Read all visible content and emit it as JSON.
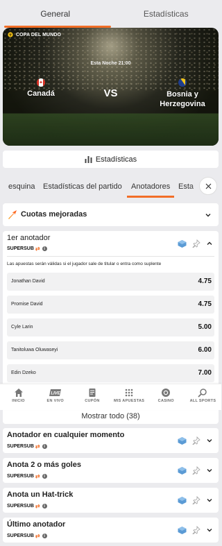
{
  "top_tabs": [
    {
      "label": "General",
      "active": true
    },
    {
      "label": "Estadísticas",
      "active": false
    }
  ],
  "match": {
    "competition": "COPA DEL MUNDO",
    "time": "Esta Noche 21:00",
    "home": "Canadá",
    "away": "Bosnia y Herzegovina",
    "vs": "VS"
  },
  "stats_button": {
    "label": "Estadísticas",
    "icon": "bar-chart-icon"
  },
  "sub_tabs": [
    {
      "label": "esquina",
      "active": false
    },
    {
      "label": "Estadísticas del partido",
      "active": false
    },
    {
      "label": "Anotadores",
      "active": true
    },
    {
      "label": "Esta",
      "active": false
    }
  ],
  "boosted": {
    "title": "Cuotas mejoradas",
    "icon": "boost-arrow-icon"
  },
  "scorer_market": {
    "title": "1er anotador",
    "supersub": "SUPERSUB",
    "note": "Las apuestas serán válidas si el jugador sale de titular o entra como suplente",
    "rows": [
      {
        "name": "Jonathan David",
        "odd": "4.75"
      },
      {
        "name": "Promise David",
        "odd": "4.75"
      },
      {
        "name": "Cyle Larin",
        "odd": "5.00"
      },
      {
        "name": "Tanitoluwa Oluwaseyi",
        "odd": "6.00"
      },
      {
        "name": "Edin Dzeko",
        "odd": "7.00"
      }
    ]
  },
  "show_all": "Mostrar todo  (38)",
  "markets": [
    {
      "title": "Anotador en cualquier momento",
      "supersub": "SUPERSUB"
    },
    {
      "title": "Anota 2 o más goles",
      "supersub": "SUPERSUB"
    },
    {
      "title": "Anota un Hat-trick",
      "supersub": "SUPERSUB"
    },
    {
      "title": "Último anotador",
      "supersub": "SUPERSUB"
    }
  ],
  "bottom_nav": [
    {
      "label": "INICIO",
      "icon": "home-icon"
    },
    {
      "label": "EN VIVO",
      "icon": "live-icon",
      "badge": "LIVE"
    },
    {
      "label": "CUPÓN",
      "icon": "coupon-icon"
    },
    {
      "label": "MIS APUESTAS",
      "icon": "grid-icon"
    },
    {
      "label": "CASINO",
      "icon": "casino-chip-icon"
    },
    {
      "label": "ALL SPORTS",
      "icon": "search-sports-icon"
    }
  ],
  "colors": {
    "accent": "#f26e27",
    "boost_start": "#f9a825",
    "boost_end": "#ff5722",
    "cube": "#5b9bd5"
  }
}
